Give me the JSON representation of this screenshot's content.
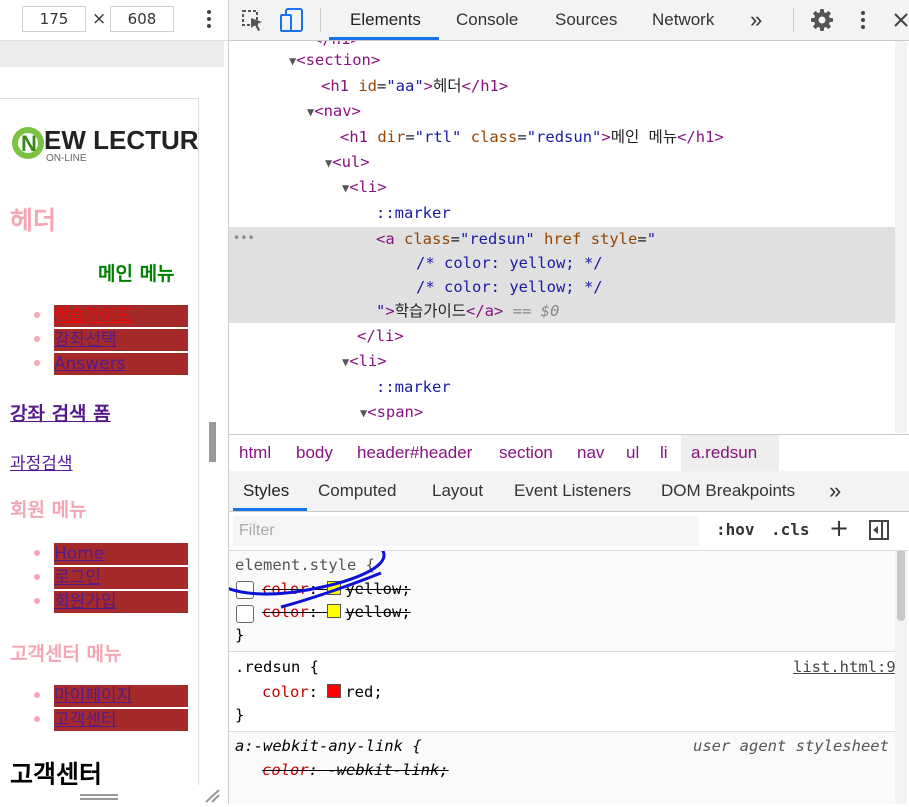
{
  "viewport": {
    "width": "175",
    "height": "608",
    "times": "×"
  },
  "preview": {
    "logo_new": "EW LECTUR",
    "logo_online": "ON-LINE",
    "header": "헤더",
    "main_menu": "메인 메뉴",
    "main_items": [
      "학습가이드",
      "강좌선택",
      "Answers"
    ],
    "search_heading": "강좌 검색 폼",
    "course_search": "과정검색",
    "member_menu": "회원 메뉴",
    "member_items": [
      "Home",
      "로그인",
      "회원가입"
    ],
    "cs_menu": "고객센터 메뉴",
    "cs_items": [
      "마이페이지",
      "고객센터"
    ],
    "cs_heading": "고객센터"
  },
  "devtools_tabs": [
    "Elements",
    "Console",
    "Sources",
    "Network"
  ],
  "more_tabs": "»",
  "dom": {
    "section_open": "<section>",
    "h1_aa": {
      "open": "<h1 ",
      "attr": "id",
      "val": "\"aa\"",
      "text": "헤더",
      "close": "</h1>"
    },
    "nav_open": "<nav>",
    "h1_rtl": {
      "text": "메인 메뉴"
    },
    "ul_open": "<ul>",
    "li_open": "<li>",
    "marker": "::marker",
    "a_comment_1": "/* color: yellow; */",
    "a_comment_2": "/* color: yellow; */",
    "a_text": "학습가이드",
    "a_eq": "== $0",
    "li_close": "</li>",
    "span_open": "<span>",
    "ellipsis": "•••"
  },
  "breadcrumbs": [
    "html",
    "body",
    "header#header",
    "section",
    "nav",
    "ul",
    "li",
    "a.redsun"
  ],
  "style_tabs": [
    "Styles",
    "Computed",
    "Layout",
    "Event Listeners",
    "DOM Breakpoints"
  ],
  "filter": {
    "placeholder": "Filter",
    "hov": ":hov",
    "cls": ".cls",
    "plus": "+"
  },
  "styles": {
    "element_style": "element.style {",
    "close_brace": "}",
    "rule1_prop": "color",
    "rule1_value": "yellow",
    "redsun_selector": ".redsun {",
    "redsun_prop": "color",
    "redsun_value": "red",
    "redsun_source": "list.html:9",
    "ua_selector": "a:-webkit-any-link {",
    "ua_source": "user agent stylesheet",
    "ua_prop": "color",
    "ua_value": "-webkit-link"
  },
  "colors": {
    "yellow": "#ffff00",
    "red": "#ff0000",
    "menu_bg": "#a52a2a",
    "pink": "#f4a6b4",
    "accent": "#1a73e8"
  }
}
